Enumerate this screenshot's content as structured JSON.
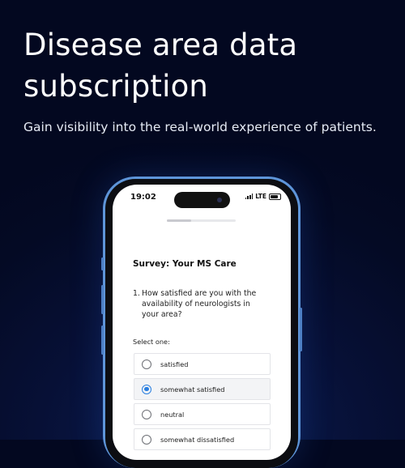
{
  "hero": {
    "title_line1": "Disease area data",
    "title_line2": "subscription",
    "subtitle": "Gain visibility into the real-world experience of patients."
  },
  "phone": {
    "status": {
      "time": "19:02",
      "network": "LTE"
    },
    "progress_fraction": 0.35,
    "survey": {
      "title": "Survey: Your MS Care",
      "question_number": "1.",
      "question_text": "How satisfied are you with the availability of neurologists in your area?",
      "select_label": "Select one:",
      "options": [
        {
          "label": "satisfied",
          "selected": false
        },
        {
          "label": "somewhat satisfied",
          "selected": true
        },
        {
          "label": "neutral",
          "selected": false
        },
        {
          "label": "somewhat dissatisfied",
          "selected": false
        }
      ]
    }
  },
  "colors": {
    "background": "#040a24",
    "phone_frame": "#5e95d9",
    "radio_selected": "#2a7fe0"
  }
}
